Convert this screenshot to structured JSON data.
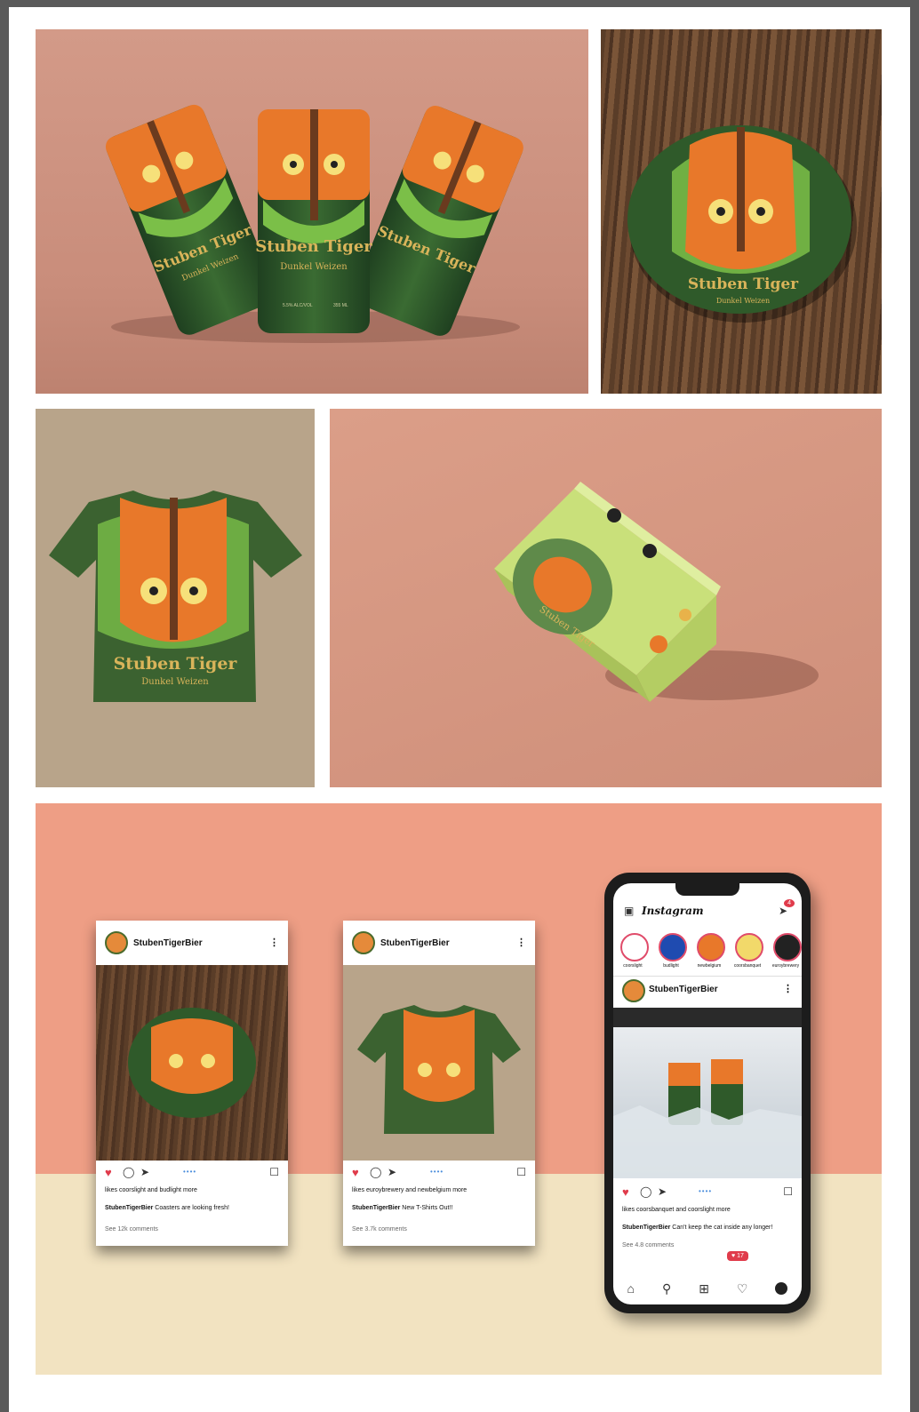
{
  "cans": {
    "brand": "Stuben Tiger",
    "style": "Dunkel Weizen",
    "abv": "5.5% ALC/VOL",
    "volume": "355 ML"
  },
  "coaster": {
    "brand": "Stuben Tiger",
    "style": "Dunkel Weizen"
  },
  "shirt": {
    "brand": "Stuben Tiger",
    "style": "Dunkel Weizen"
  },
  "box": {
    "brand": "Stuben Tiger"
  },
  "posts": [
    {
      "username": "StubenTigerBier",
      "liked_by": "likes coorslight and budlight more",
      "caption_user": "StubenTigerBier",
      "caption": "Coasters are looking fresh!",
      "comments": "See 12k comments"
    },
    {
      "username": "StubenTigerBier",
      "liked_by": "likes euroybrewery and newbelgium more",
      "caption_user": "StubenTigerBier",
      "caption": "New T-Shirts Out!!",
      "comments": "See 3.7k comments"
    }
  ],
  "phone": {
    "app_title": "Instagram",
    "notif_count": "4",
    "stories": [
      "coorslight",
      "budlight",
      "newbelgium",
      "coorsbanquet",
      "euroybrewery"
    ],
    "username": "StubenTigerBier",
    "liked_by": "likes coorsbanquet and coorslight more",
    "caption_user": "StubenTigerBier",
    "caption": "Can't keep the cat inside any longer!",
    "comments": "See 4.8 comments",
    "like_badge": "17"
  },
  "colors": {
    "can_green": "#2f5a2a",
    "tiger_orange": "#e8782a",
    "leaf_green": "#7bbf48",
    "gold": "#d9b45a"
  }
}
